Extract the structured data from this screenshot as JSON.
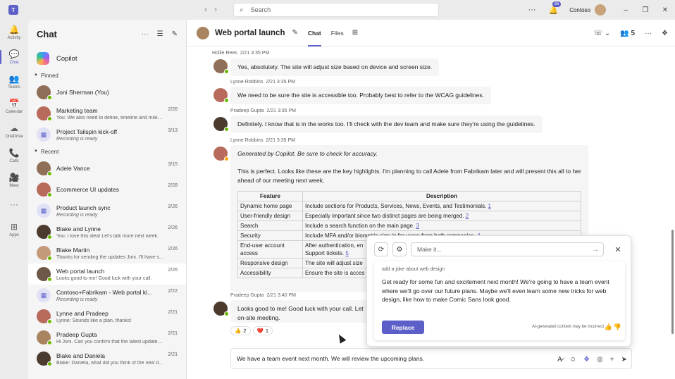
{
  "titlebar": {
    "search_placeholder": "Search",
    "notification_count": "36",
    "org_name": "Contoso"
  },
  "rail": [
    {
      "label": "Activity",
      "icon": "bell-icon",
      "glyph": "🔔"
    },
    {
      "label": "Chat",
      "icon": "chat-icon",
      "glyph": "💬"
    },
    {
      "label": "Teams",
      "icon": "teams-icon",
      "glyph": "👥"
    },
    {
      "label": "Calendar",
      "icon": "calendar-icon",
      "glyph": "📅"
    },
    {
      "label": "OneDrive",
      "icon": "cloud-icon",
      "glyph": "☁"
    },
    {
      "label": "Calls",
      "icon": "phone-icon",
      "glyph": "📞"
    },
    {
      "label": "Meet",
      "icon": "video-icon",
      "glyph": "🎥"
    },
    {
      "label": "",
      "icon": "more-icon",
      "glyph": "···"
    },
    {
      "label": "Apps",
      "icon": "apps-icon",
      "glyph": "⊞"
    }
  ],
  "chat_panel": {
    "title": "Chat",
    "copilot_label": "Copilot",
    "pinned_label": "Pinned",
    "recent_label": "Recent",
    "pinned": [
      {
        "name": "Joni Sherman (You)",
        "preview": "",
        "date": ""
      },
      {
        "name": "Marketing team",
        "preview": "You: We also need to define, timeline and miles...",
        "date": "2/26"
      },
      {
        "name": "Project Tailspin kick-off",
        "preview": "Recording is ready",
        "date": "3/13"
      }
    ],
    "recent": [
      {
        "name": "Adele Vance",
        "preview": "",
        "date": "3/15"
      },
      {
        "name": "Ecommerce UI updates",
        "preview": "",
        "date": "2/28"
      },
      {
        "name": "Product launch sync",
        "preview": "Recording is ready",
        "date": "2/26"
      },
      {
        "name": "Blake and Lynne",
        "preview": "You: I love this idea! Let's talk more next week.",
        "date": "2/26"
      },
      {
        "name": "Blake Martin",
        "preview": "Thanks for sending the updates Joni. I'll have s...",
        "date": "2/26"
      },
      {
        "name": "Web portal launch",
        "preview": "Looks good to me! Good luck with your call.",
        "date": "2/26"
      },
      {
        "name": "Contoso+Fabrikam - Web portal ki...",
        "preview": "Recording is ready",
        "date": "2/22"
      },
      {
        "name": "Lynne and Pradeep",
        "preview": "Lynne: Sounds like a plan, thanks!",
        "date": "2/21"
      },
      {
        "name": "Pradeep Gupta",
        "preview": "Hi Joni. Can you confirm that the latest updates...",
        "date": "2/21"
      },
      {
        "name": "Blake and Daniela",
        "preview": "Blake: Daniela, what did you think of the new d...",
        "date": "2/21"
      }
    ]
  },
  "header": {
    "title": "Web portal launch",
    "tab_chat": "Chat",
    "tab_files": "Files",
    "participants": "5"
  },
  "messages": [
    {
      "author": "Hollie Rees",
      "time": "2/21 3:35 PM",
      "text": "Yes, absolutely. The site will adjust size based on device and screen size."
    },
    {
      "author": "Lynne Robbins",
      "time": "2/21 3:35 PM",
      "text": "We need to be sure the site is accessible too. Probably best to refer to the WCAG guidelines."
    },
    {
      "author": "Pradeep Gupta",
      "time": "2/21 3:35 PM",
      "text": "Definitely. I know that is in the works too. I'll check with the dev team and make sure they're using the guidelines."
    },
    {
      "author": "Lynne Robbins",
      "time": "2/21 3:35 PM",
      "disclaimer": "Generated by Copilot. Be sure to check for accuracy.",
      "text": "This is perfect. Looks like these are the key highlights. I'm planning to call Adele from Fabrikam later and will present this all to her ahead of our meeting next week."
    },
    {
      "author": "Pradeep Gupta",
      "time": "2/21 3:40 PM",
      "text": "Looks good to me! Good luck with your call. Let",
      "text2": "on-site meeting."
    }
  ],
  "table": {
    "headers": [
      "Feature",
      "Description"
    ],
    "rows": [
      {
        "feature": "Dynamic home page",
        "desc": "Include sections for Products, Services, News, Events, and Testimonials.",
        "ref": "1"
      },
      {
        "feature": "User-friendly design",
        "desc": "Especially important since two distinct pages are being merged.",
        "ref": "2"
      },
      {
        "feature": "Search",
        "desc": "Include a search function on the main page.",
        "ref": "3"
      },
      {
        "feature": "Security",
        "desc": "Include MFA and/or biometric sign-in for users from both companies.",
        "ref": "4"
      },
      {
        "feature": "End-user account access",
        "desc": "After authentication, en",
        "desc2": "Support tickets.",
        "ref": "5"
      },
      {
        "feature": "Responsive design",
        "desc": "The site will adjust size",
        "ref": ""
      },
      {
        "feature": "Accessibility",
        "desc": "Ensure the site is acces",
        "ref": ""
      }
    ]
  },
  "reactions": [
    {
      "emoji": "👍",
      "count": "2"
    },
    {
      "emoji": "❤️",
      "count": "1"
    }
  ],
  "compose": {
    "text": "We have a team event next month. We will review the upcoming plans."
  },
  "ai_popup": {
    "input_placeholder": "Make it...",
    "prompt": "add a joke about web design",
    "generated": "Get ready for some fun and excitement next month! We're going to have a team event where we'll go over our future plans. Maybe we'll even learn some new tricks for web design, like how to make Comic Sans look good.",
    "replace_label": "Replace",
    "disclaimer": "AI-generated content may be incorrect"
  }
}
